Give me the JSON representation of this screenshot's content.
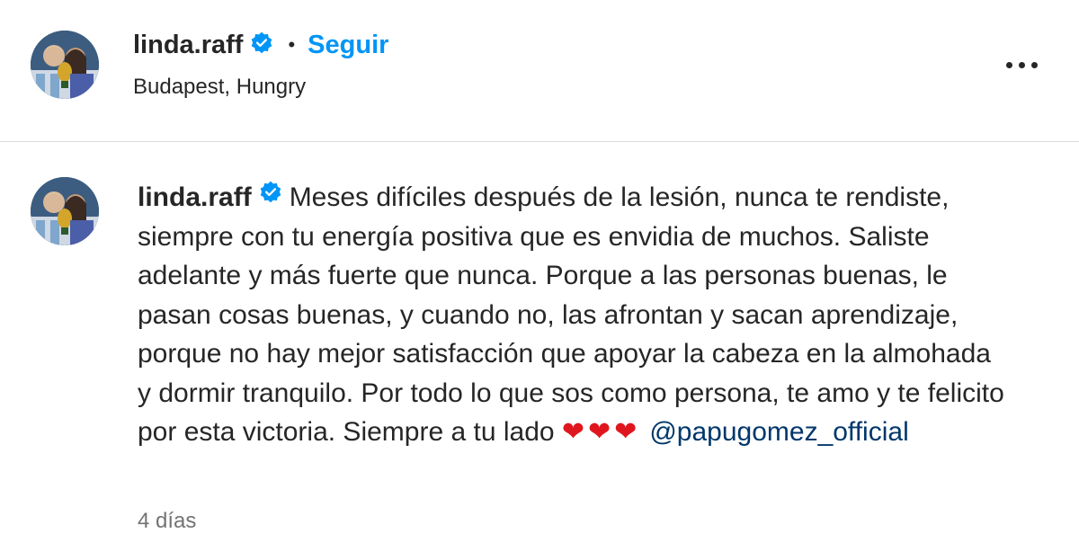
{
  "post_header": {
    "username": "linda.raff",
    "separator": "•",
    "follow_label": "Seguir",
    "location": "Budapest, Hungry",
    "more_icon": "more-horizontal-icon",
    "verified_icon": "verified-badge-icon"
  },
  "caption": {
    "username": "linda.raff",
    "text": "Meses difíciles después de la lesión, nunca te rendiste, siempre con tu energía positiva que es envidia de muchos. Saliste adelante y más fuerte que nunca. Porque a las personas buenas, le pasan cosas buenas, y cuando no, las afrontan y sacan aprendizaje, porque no hay mejor satisfacción que apoyar la cabeza en la almohada y dormir tranquilo. Por todo lo que sos como persona, te amo y te felicito por esta victoria. Siempre a tu lado ",
    "hearts": "❤❤❤",
    "mention": "@papugomez_official",
    "timestamp": "4 días"
  },
  "colors": {
    "follow_blue": "#0095f6",
    "mention_blue": "#00376b",
    "verified_blue": "#0095f6",
    "heart_red": "#e0161e",
    "secondary_text": "#737373",
    "divider": "#dbdbdb"
  }
}
